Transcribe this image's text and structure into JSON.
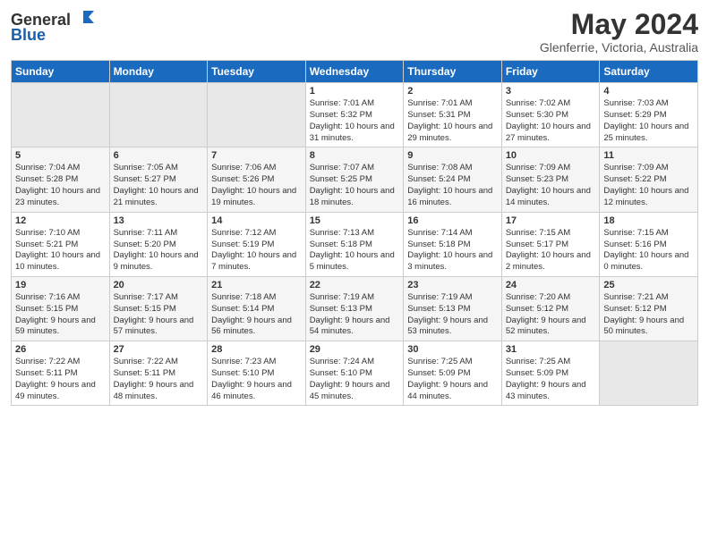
{
  "logo": {
    "general": "General",
    "blue": "Blue"
  },
  "header": {
    "month": "May 2024",
    "location": "Glenferrie, Victoria, Australia"
  },
  "weekdays": [
    "Sunday",
    "Monday",
    "Tuesday",
    "Wednesday",
    "Thursday",
    "Friday",
    "Saturday"
  ],
  "weeks": [
    [
      {
        "day": "",
        "empty": true
      },
      {
        "day": "",
        "empty": true
      },
      {
        "day": "",
        "empty": true
      },
      {
        "day": "1",
        "sunrise": "7:01 AM",
        "sunset": "5:32 PM",
        "daylight": "10 hours and 31 minutes."
      },
      {
        "day": "2",
        "sunrise": "7:01 AM",
        "sunset": "5:31 PM",
        "daylight": "10 hours and 29 minutes."
      },
      {
        "day": "3",
        "sunrise": "7:02 AM",
        "sunset": "5:30 PM",
        "daylight": "10 hours and 27 minutes."
      },
      {
        "day": "4",
        "sunrise": "7:03 AM",
        "sunset": "5:29 PM",
        "daylight": "10 hours and 25 minutes."
      }
    ],
    [
      {
        "day": "5",
        "sunrise": "7:04 AM",
        "sunset": "5:28 PM",
        "daylight": "10 hours and 23 minutes."
      },
      {
        "day": "6",
        "sunrise": "7:05 AM",
        "sunset": "5:27 PM",
        "daylight": "10 hours and 21 minutes."
      },
      {
        "day": "7",
        "sunrise": "7:06 AM",
        "sunset": "5:26 PM",
        "daylight": "10 hours and 19 minutes."
      },
      {
        "day": "8",
        "sunrise": "7:07 AM",
        "sunset": "5:25 PM",
        "daylight": "10 hours and 18 minutes."
      },
      {
        "day": "9",
        "sunrise": "7:08 AM",
        "sunset": "5:24 PM",
        "daylight": "10 hours and 16 minutes."
      },
      {
        "day": "10",
        "sunrise": "7:09 AM",
        "sunset": "5:23 PM",
        "daylight": "10 hours and 14 minutes."
      },
      {
        "day": "11",
        "sunrise": "7:09 AM",
        "sunset": "5:22 PM",
        "daylight": "10 hours and 12 minutes."
      }
    ],
    [
      {
        "day": "12",
        "sunrise": "7:10 AM",
        "sunset": "5:21 PM",
        "daylight": "10 hours and 10 minutes."
      },
      {
        "day": "13",
        "sunrise": "7:11 AM",
        "sunset": "5:20 PM",
        "daylight": "10 hours and 9 minutes."
      },
      {
        "day": "14",
        "sunrise": "7:12 AM",
        "sunset": "5:19 PM",
        "daylight": "10 hours and 7 minutes."
      },
      {
        "day": "15",
        "sunrise": "7:13 AM",
        "sunset": "5:18 PM",
        "daylight": "10 hours and 5 minutes."
      },
      {
        "day": "16",
        "sunrise": "7:14 AM",
        "sunset": "5:18 PM",
        "daylight": "10 hours and 3 minutes."
      },
      {
        "day": "17",
        "sunrise": "7:15 AM",
        "sunset": "5:17 PM",
        "daylight": "10 hours and 2 minutes."
      },
      {
        "day": "18",
        "sunrise": "7:15 AM",
        "sunset": "5:16 PM",
        "daylight": "10 hours and 0 minutes."
      }
    ],
    [
      {
        "day": "19",
        "sunrise": "7:16 AM",
        "sunset": "5:15 PM",
        "daylight": "9 hours and 59 minutes."
      },
      {
        "day": "20",
        "sunrise": "7:17 AM",
        "sunset": "5:15 PM",
        "daylight": "9 hours and 57 minutes."
      },
      {
        "day": "21",
        "sunrise": "7:18 AM",
        "sunset": "5:14 PM",
        "daylight": "9 hours and 56 minutes."
      },
      {
        "day": "22",
        "sunrise": "7:19 AM",
        "sunset": "5:13 PM",
        "daylight": "9 hours and 54 minutes."
      },
      {
        "day": "23",
        "sunrise": "7:19 AM",
        "sunset": "5:13 PM",
        "daylight": "9 hours and 53 minutes."
      },
      {
        "day": "24",
        "sunrise": "7:20 AM",
        "sunset": "5:12 PM",
        "daylight": "9 hours and 52 minutes."
      },
      {
        "day": "25",
        "sunrise": "7:21 AM",
        "sunset": "5:12 PM",
        "daylight": "9 hours and 50 minutes."
      }
    ],
    [
      {
        "day": "26",
        "sunrise": "7:22 AM",
        "sunset": "5:11 PM",
        "daylight": "9 hours and 49 minutes."
      },
      {
        "day": "27",
        "sunrise": "7:22 AM",
        "sunset": "5:11 PM",
        "daylight": "9 hours and 48 minutes."
      },
      {
        "day": "28",
        "sunrise": "7:23 AM",
        "sunset": "5:10 PM",
        "daylight": "9 hours and 46 minutes."
      },
      {
        "day": "29",
        "sunrise": "7:24 AM",
        "sunset": "5:10 PM",
        "daylight": "9 hours and 45 minutes."
      },
      {
        "day": "30",
        "sunrise": "7:25 AM",
        "sunset": "5:09 PM",
        "daylight": "9 hours and 44 minutes."
      },
      {
        "day": "31",
        "sunrise": "7:25 AM",
        "sunset": "5:09 PM",
        "daylight": "9 hours and 43 minutes."
      },
      {
        "day": "",
        "empty": true
      }
    ]
  ]
}
